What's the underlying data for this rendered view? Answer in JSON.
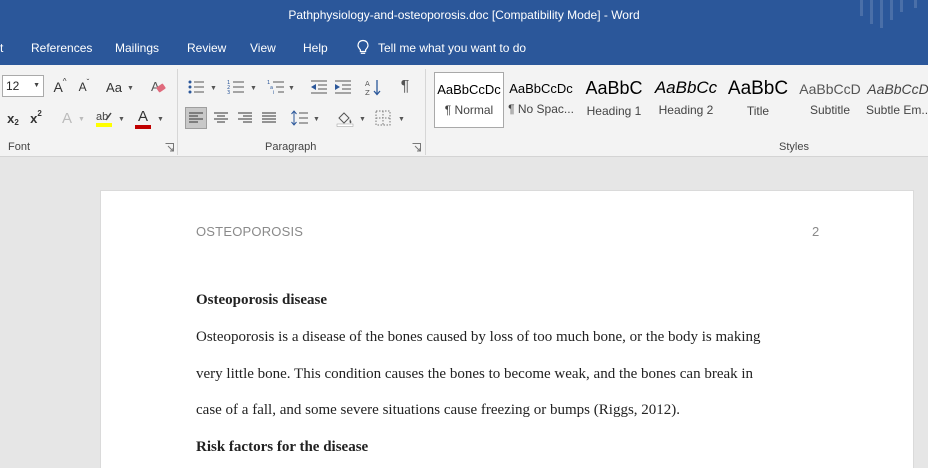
{
  "window": {
    "title": "Pathphysiology-and-osteoporosis.doc [Compatibility Mode]  -  Word"
  },
  "menu": {
    "tabs": [
      "t",
      "References",
      "Mailings",
      "Review",
      "View",
      "Help"
    ],
    "tell_me": "Tell me what you want to do"
  },
  "ribbon": {
    "font_size": "12",
    "groups": {
      "font": "Font",
      "paragraph": "Paragraph",
      "styles": "Styles"
    },
    "glyphs": {
      "grow": "A",
      "shrink": "A",
      "case": "Aa",
      "subscript": "x",
      "subscript_mark": "2",
      "superscript": "x",
      "superscript_mark": "2",
      "text_effects": "A",
      "font_color": "A",
      "pilcrow": "¶"
    },
    "styles": [
      {
        "sample": "AaBbCcDc",
        "name": "¶ Normal"
      },
      {
        "sample": "AaBbCcDc",
        "name": "¶ No Spac..."
      },
      {
        "sample": "AaBbC",
        "name": "Heading 1"
      },
      {
        "sample": "AaBbCc",
        "name": "Heading 2"
      },
      {
        "sample": "AaBbC",
        "name": "Title"
      },
      {
        "sample": "AaBbCcD",
        "name": "Subtitle"
      },
      {
        "sample": "AaBbCcD",
        "name": "Subtle Em..."
      }
    ],
    "colors": {
      "highlight": "#ffff00",
      "font_color": "#c00000"
    }
  },
  "document": {
    "header_text": "OSTEOPOROSIS",
    "page_number": "2",
    "heading1": "Osteoporosis disease",
    "lines": [
      "Osteoporosis is a disease of the bones caused by loss of too much bone, or the body is making",
      "very little bone. This condition causes the bones to become weak, and the bones can break in",
      "case of a fall, and some severe situations cause freezing or bumps (Riggs, 2012)."
    ],
    "heading2": "Risk factors for the disease"
  },
  "theme": {
    "word_blue": "#2b579a"
  }
}
